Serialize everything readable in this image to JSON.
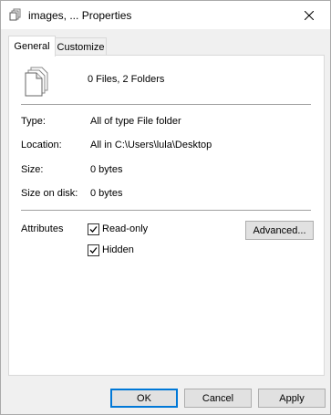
{
  "window": {
    "title": "images, ... Properties"
  },
  "tabs": [
    {
      "label": "General",
      "active": true
    },
    {
      "label": "Customize",
      "active": false
    }
  ],
  "general": {
    "summary": "0 Files, 2 Folders",
    "fields": [
      {
        "label": "Type:",
        "value": "All of type File folder"
      },
      {
        "label": "Location:",
        "value": "All in C:\\Users\\lula\\Desktop"
      },
      {
        "label": "Size:",
        "value": "0 bytes"
      },
      {
        "label": "Size on disk:",
        "value": "0 bytes"
      }
    ],
    "attributes_label": "Attributes",
    "attributes": [
      {
        "label": "Read-only",
        "checked": true
      },
      {
        "label": "Hidden",
        "checked": true
      }
    ],
    "advanced_label": "Advanced..."
  },
  "buttons": {
    "ok": "OK",
    "cancel": "Cancel",
    "apply": "Apply"
  },
  "colors": {
    "accent": "#0078d7",
    "dialog_bg": "#f0f0f0",
    "panel_bg": "#ffffff"
  },
  "icons": {
    "title": "multiple-files-icon",
    "summary": "multiple-files-icon",
    "close": "close-icon",
    "check": "checkmark-icon"
  }
}
